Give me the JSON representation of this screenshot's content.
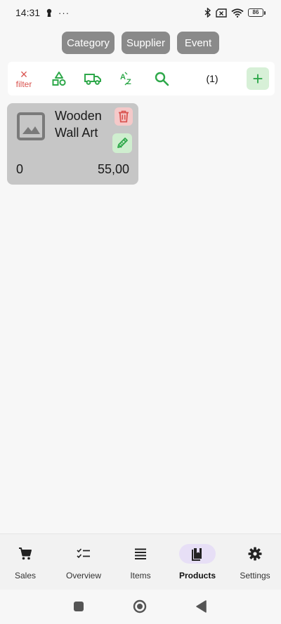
{
  "status_bar": {
    "time": "14:31",
    "dots": "···",
    "battery": "86"
  },
  "filter_chips": [
    {
      "label": "Category"
    },
    {
      "label": "Supplier"
    },
    {
      "label": "Event"
    }
  ],
  "toolbar": {
    "filter_symbol": "×",
    "filter_label": "filter",
    "count": "(1)",
    "icons": [
      "shapes-icon",
      "truck-icon",
      "sort-az-icon",
      "search-icon"
    ],
    "add_symbol": "+"
  },
  "products": [
    {
      "name": "Wooden Wall Art",
      "quantity": "0",
      "price": "55,00"
    }
  ],
  "bottom_nav": {
    "items": [
      {
        "label": "Sales",
        "icon": "cart-icon"
      },
      {
        "label": "Overview",
        "icon": "checklist-icon"
      },
      {
        "label": "Items",
        "icon": "list-icon"
      },
      {
        "label": "Products",
        "icon": "book-icon",
        "active": true
      },
      {
        "label": "Settings",
        "icon": "gear-icon"
      }
    ]
  },
  "colors": {
    "accent_green": "#2ea84a",
    "filter_red": "#d9534f",
    "chip_grey": "#8a8a8a",
    "card_grey": "#c6c6c6",
    "active_nav": "#e7dff6"
  }
}
